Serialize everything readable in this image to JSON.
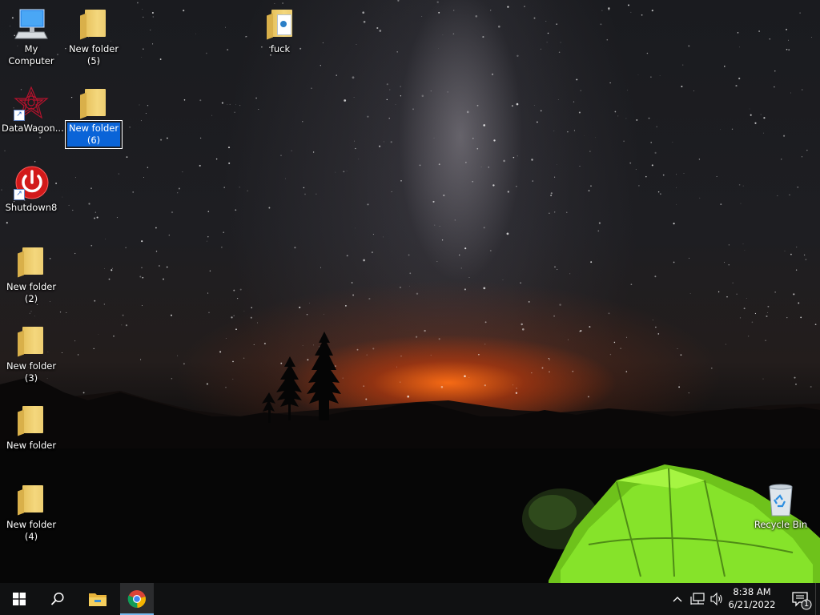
{
  "desktop": {
    "icons": [
      {
        "label": "My Computer"
      },
      {
        "label": "New folder\n(5)"
      },
      {
        "label": "fuck"
      },
      {
        "label": "DataWagon..."
      },
      {
        "label": "New folder\n(6)"
      },
      {
        "label": "Shutdown8"
      },
      {
        "label": "New folder\n(2)"
      },
      {
        "label": "New folder\n(3)"
      },
      {
        "label": "New folder"
      },
      {
        "label": "New folder\n(4)"
      },
      {
        "label": "Recycle Bin"
      }
    ]
  },
  "taskbar": {
    "start_icon": "windows-logo-icon",
    "search_icon": "search-icon",
    "file_explorer_icon": "file-explorer-icon",
    "chrome_icon": "chrome-icon",
    "tray": {
      "time": "8:38 AM",
      "date": "6/21/2022",
      "notification_count": "1"
    }
  },
  "colors": {
    "taskbar": "#101112",
    "selection": "#0a64d8",
    "active_indicator": "#76b9ed"
  }
}
